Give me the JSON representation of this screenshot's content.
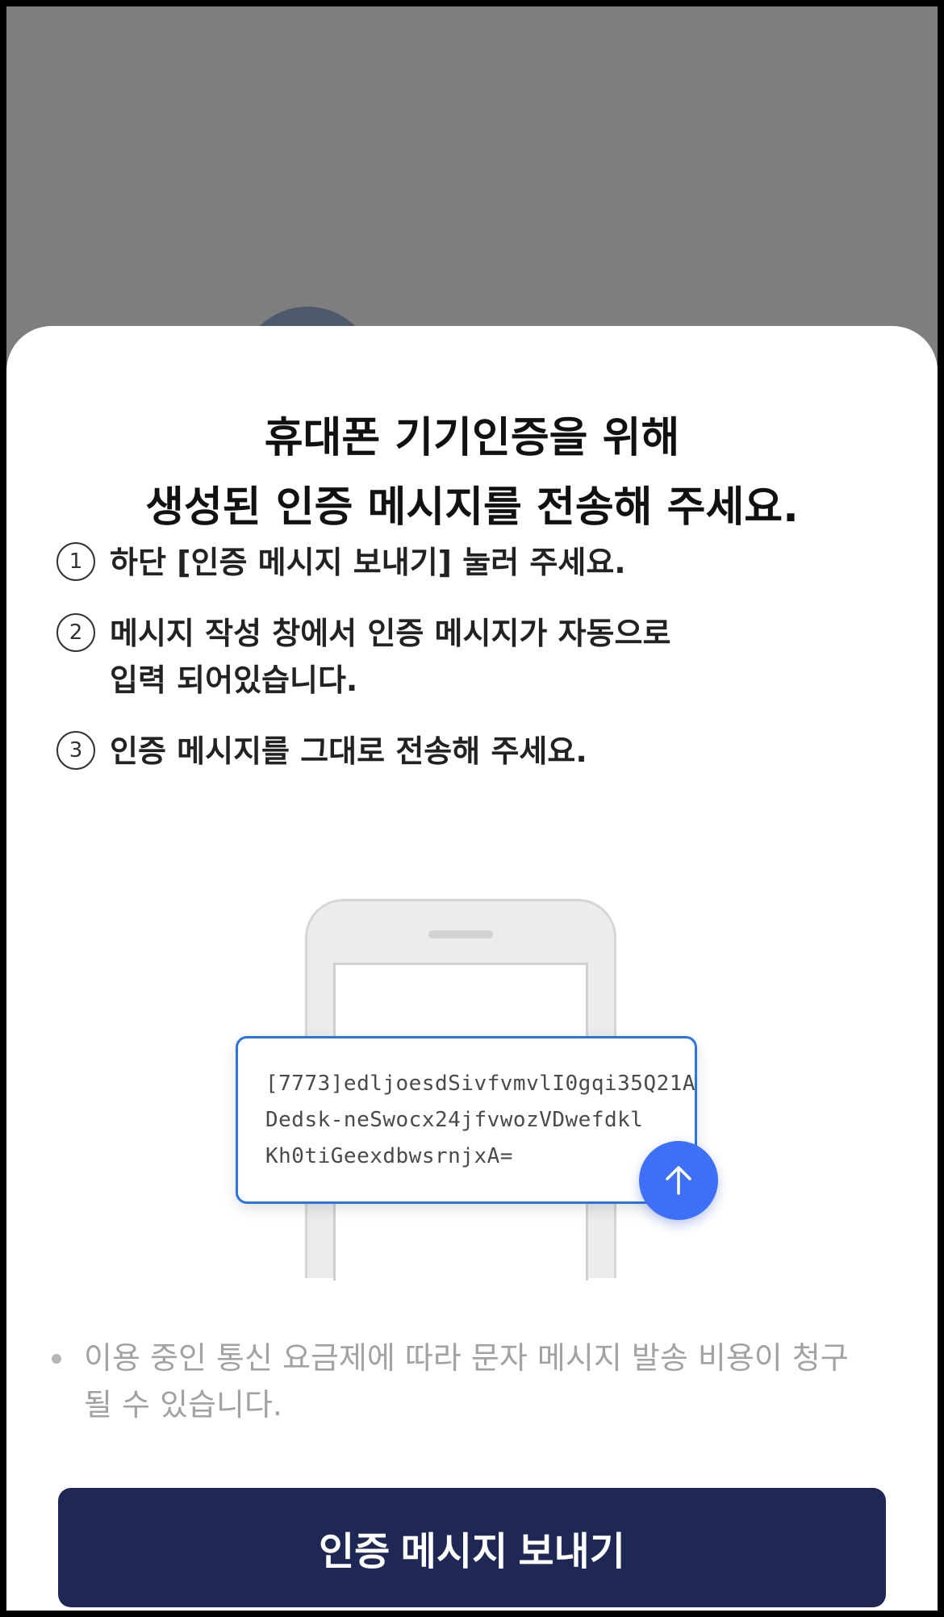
{
  "modal": {
    "title_line1": "휴대폰 기기인증을 위해",
    "title_line2": "생성된 인증 메시지를 전송해 주세요."
  },
  "steps": [
    {
      "num": "1",
      "line1": "하단 [인증 메시지 보내기] 눌러 주세요.",
      "line2": ""
    },
    {
      "num": "2",
      "line1": "메시지 작성 창에서 인증 메시지가 자동으로",
      "line2": "입력 되어있습니다."
    },
    {
      "num": "3",
      "line1": "인증 메시지를 그대로 전송해 주세요.",
      "line2": ""
    }
  ],
  "illustration": {
    "message_line1": "[7773]edljoesdSivfvmvlI0gqi35Q21A",
    "message_line2": "Dedsk-neSwocx24jfvwozVDwefdkl",
    "message_line3": "Kh0tiGeexdbwsrnjxA=",
    "send_icon": "arrow-up-icon"
  },
  "notice": {
    "line1": "이용 중인 통신 요금제에 따라 문자 메시지 발송 비용이 청구",
    "line2": "될 수 있습니다."
  },
  "cta": {
    "label": "인증 메시지 보내기"
  },
  "colors": {
    "overlay": "#7e7e7e",
    "cta_bg": "#1f2855",
    "accent_blue": "#3d6ff7",
    "card_border": "#2a73e8"
  }
}
